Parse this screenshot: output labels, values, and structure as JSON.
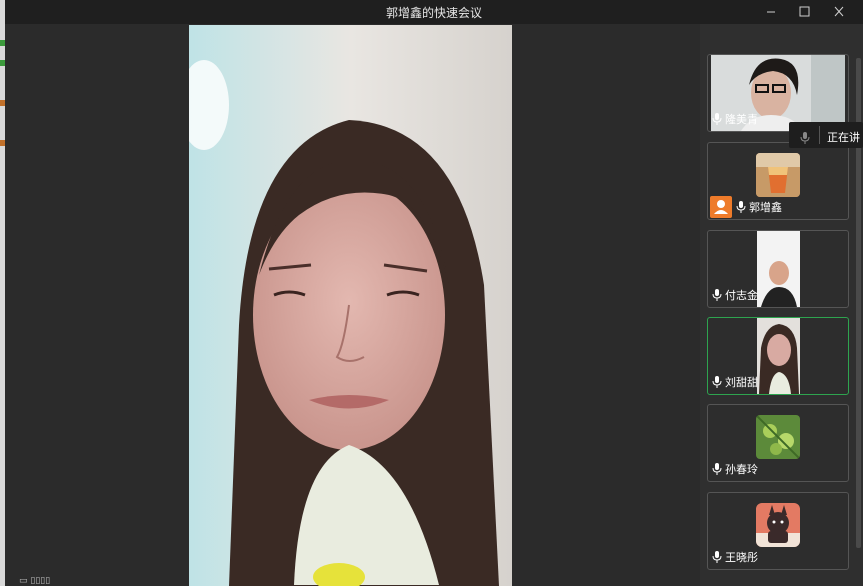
{
  "window": {
    "title": "郭增鑫的快速会议"
  },
  "participants": [
    {
      "name": "隆美青"
    },
    {
      "name": "郭增鑫"
    },
    {
      "name": "付志金"
    },
    {
      "name": "刘甜甜"
    },
    {
      "name": "孙春玲"
    },
    {
      "name": "王晓彤"
    }
  ],
  "tooltip": {
    "text": "正在讲"
  },
  "icons": {
    "minimize": "minimize-icon",
    "maximize": "maximize-icon",
    "close": "close-icon",
    "mic": "microphone-icon",
    "host": "host-icon"
  },
  "colors": {
    "active_border": "#2ea44f",
    "host_badge": "#ee7b2a",
    "title_bar": "#1f1f1f"
  }
}
